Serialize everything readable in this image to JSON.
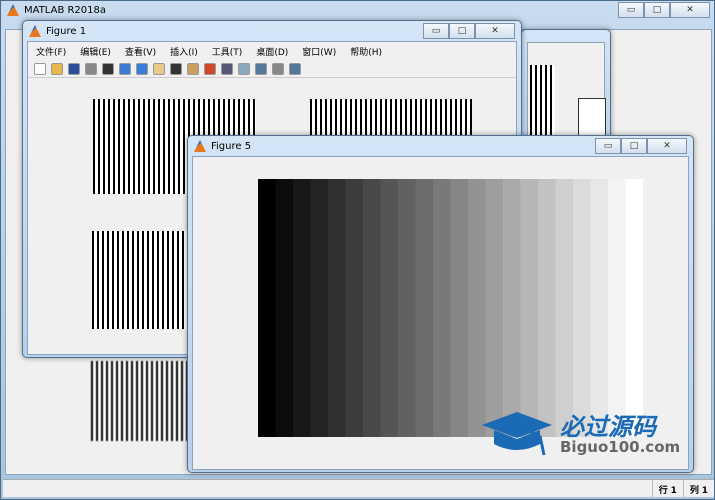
{
  "main_window": {
    "title": "MATLAB R2018a",
    "status": {
      "row_label": "行",
      "row_value": "1",
      "col_label": "列",
      "col_value": "1"
    }
  },
  "figure1": {
    "title": "Figure 1",
    "menu": [
      "文件(F)",
      "编辑(E)",
      "查看(V)",
      "插入(I)",
      "工具(T)",
      "桌面(D)",
      "窗口(W)",
      "帮助(H)"
    ],
    "toolbar": [
      "new-file-icon",
      "open-icon",
      "save-icon",
      "print-icon",
      "pointer-icon",
      "zoom-in-icon",
      "zoom-out-icon",
      "pan-icon",
      "rotate-icon",
      "data-cursor-icon",
      "brush-icon",
      "link-icon",
      "colorbar-icon",
      "legend-icon",
      "hide-plot-tools-icon",
      "show-plot-tools-icon"
    ]
  },
  "figure5": {
    "title": "Figure 5",
    "chart_data": {
      "type": "heatmap",
      "description_levels": 22,
      "values": [
        0,
        0.048,
        0.095,
        0.143,
        0.19,
        0.238,
        0.286,
        0.333,
        0.381,
        0.429,
        0.476,
        0.524,
        0.571,
        0.619,
        0.667,
        0.714,
        0.762,
        0.81,
        0.857,
        0.905,
        0.952,
        1
      ],
      "colormap": "gray"
    }
  },
  "watermark": {
    "cn": "必过源码",
    "en": "Biguo100.com",
    "color": "#1a6ab5"
  }
}
